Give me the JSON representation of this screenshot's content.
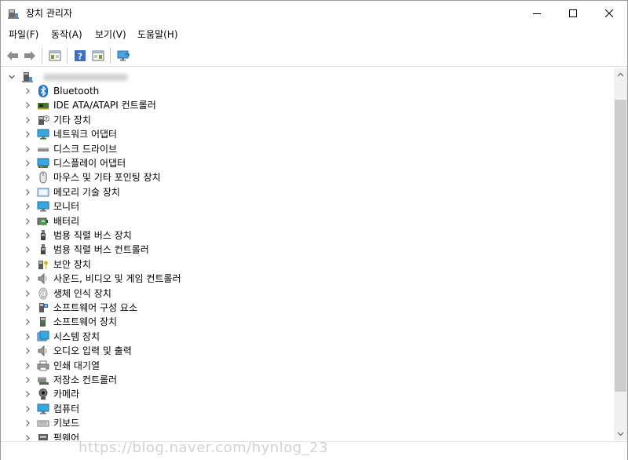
{
  "window": {
    "title": "장치 관리자"
  },
  "menu": [
    {
      "label": "파일(F)"
    },
    {
      "label": "동작(A)"
    },
    {
      "label": "보기(V)"
    },
    {
      "label": "도움말(H)"
    }
  ],
  "tree": {
    "root_label": "",
    "items": [
      {
        "label": "Bluetooth",
        "icon": "bluetooth-icon"
      },
      {
        "label": "IDE ATA/ATAPI 컨트롤러",
        "icon": "ide-controller-icon"
      },
      {
        "label": "기타 장치",
        "icon": "other-device-icon"
      },
      {
        "label": "네트워크 어댑터",
        "icon": "network-adapter-icon"
      },
      {
        "label": "디스크 드라이브",
        "icon": "disk-drive-icon"
      },
      {
        "label": "디스플레이 어댑터",
        "icon": "display-adapter-icon"
      },
      {
        "label": "마우스 및 기타 포인팅 장치",
        "icon": "mouse-icon"
      },
      {
        "label": "메모리 기술 장치",
        "icon": "memory-icon"
      },
      {
        "label": "모니터",
        "icon": "monitor-icon"
      },
      {
        "label": "배터리",
        "icon": "battery-icon"
      },
      {
        "label": "범용 직렬 버스 장치",
        "icon": "usb-device-icon"
      },
      {
        "label": "범용 직렬 버스 컨트롤러",
        "icon": "usb-controller-icon"
      },
      {
        "label": "보안 장치",
        "icon": "security-device-icon"
      },
      {
        "label": "사운드, 비디오 및 게임 컨트롤러",
        "icon": "sound-icon"
      },
      {
        "label": "생체 인식 장치",
        "icon": "biometric-icon"
      },
      {
        "label": "소프트웨어 구성 요소",
        "icon": "software-component-icon"
      },
      {
        "label": "소프트웨어 장치",
        "icon": "software-device-icon"
      },
      {
        "label": "시스템 장치",
        "icon": "system-device-icon"
      },
      {
        "label": "오디오 입력 및 출력",
        "icon": "audio-io-icon"
      },
      {
        "label": "인쇄 대기열",
        "icon": "print-queue-icon"
      },
      {
        "label": "저장소 컨트롤러",
        "icon": "storage-controller-icon"
      },
      {
        "label": "카메라",
        "icon": "camera-icon"
      },
      {
        "label": "컴퓨터",
        "icon": "computer-icon"
      },
      {
        "label": "키보드",
        "icon": "keyboard-icon"
      },
      {
        "label": "펌웨어",
        "icon": "firmware-icon"
      }
    ]
  },
  "watermark": "https://blog.naver.com/hynlog_23"
}
